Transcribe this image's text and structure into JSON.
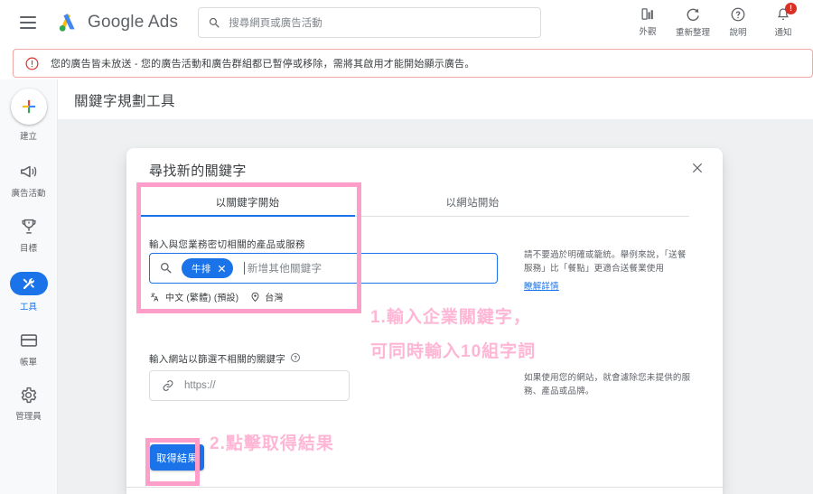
{
  "topbar": {
    "menu_icon": "hamburger-menu-icon",
    "brand": "Google Ads",
    "brand_google": "Google",
    "brand_ads": " Ads",
    "search": {
      "icon": "search-icon",
      "placeholder": "搜尋網頁或廣告活動",
      "value": ""
    },
    "icons": [
      {
        "icon": "appearance-icon",
        "label": "外觀"
      },
      {
        "icon": "refresh-icon",
        "label": "重新整理"
      },
      {
        "icon": "help-icon",
        "label": "說明"
      },
      {
        "icon": "notifications-bell-icon",
        "label": "通知",
        "badge": "!"
      }
    ]
  },
  "alert": {
    "icon": "error-circle-icon",
    "text": "您的廣告皆未放送 - 您的廣告活動和廣告群組都已暫停或移除，需將其啟用才能開始顯示廣告。",
    "border_color": "#f2a8a3"
  },
  "sidebar": {
    "items": [
      {
        "icon": "plus-icon",
        "label": "建立",
        "active": false
      },
      {
        "icon": "megaphone-icon",
        "label": "廣告活動",
        "active": false
      },
      {
        "icon": "trophy-icon",
        "label": "目標",
        "active": false
      },
      {
        "icon": "tools-icon",
        "label": "工具",
        "active": true
      },
      {
        "icon": "billing-card-icon",
        "label": "帳單",
        "active": false
      },
      {
        "icon": "gear-icon",
        "label": "管理員",
        "active": false
      }
    ],
    "active_color": "#1a73e8"
  },
  "page": {
    "title": "關鍵字規劃工具"
  },
  "dialog": {
    "title": "尋找新的關鍵字",
    "close_icon": "close-icon",
    "tabs": [
      {
        "label": "以關鍵字開始",
        "active": true
      },
      {
        "label": "以網站開始",
        "active": false
      }
    ],
    "keyword_section": {
      "label": "輸入與您業務密切相關的產品或服務",
      "search_icon": "search-icon",
      "chips": [
        {
          "text": "牛排",
          "remove_icon": "close-icon"
        }
      ],
      "placeholder": "新增其他關鍵字",
      "language": {
        "icon": "translate-icon",
        "text": "中文 (繁體) (預設)"
      },
      "location": {
        "icon": "location-pin-icon",
        "text": "台灣"
      },
      "hint": "請不要過於明確或籠統。舉例來說，「送餐服務」比「餐點」更適合送餐業使用",
      "hint_link": "瞭解詳情"
    },
    "site_section": {
      "label": "輸入網站以篩選不相關的關鍵字",
      "help_icon": "help-circle-icon",
      "link_icon": "link-icon",
      "placeholder": "https://",
      "value": "",
      "hint": "如果使用您的網站，就會濾除您未提供的服務、產品或品牌。"
    },
    "submit_button": "取得結果",
    "accent_color": "#1a73e8"
  },
  "annotations": {
    "color": "#ffb6d5",
    "box_color": "#ff9ec8",
    "step1_line1": "1.輸入企業關鍵字，",
    "step1_line2": "可同時輸入10組字詞",
    "step2": "2.點擊取得結果"
  }
}
